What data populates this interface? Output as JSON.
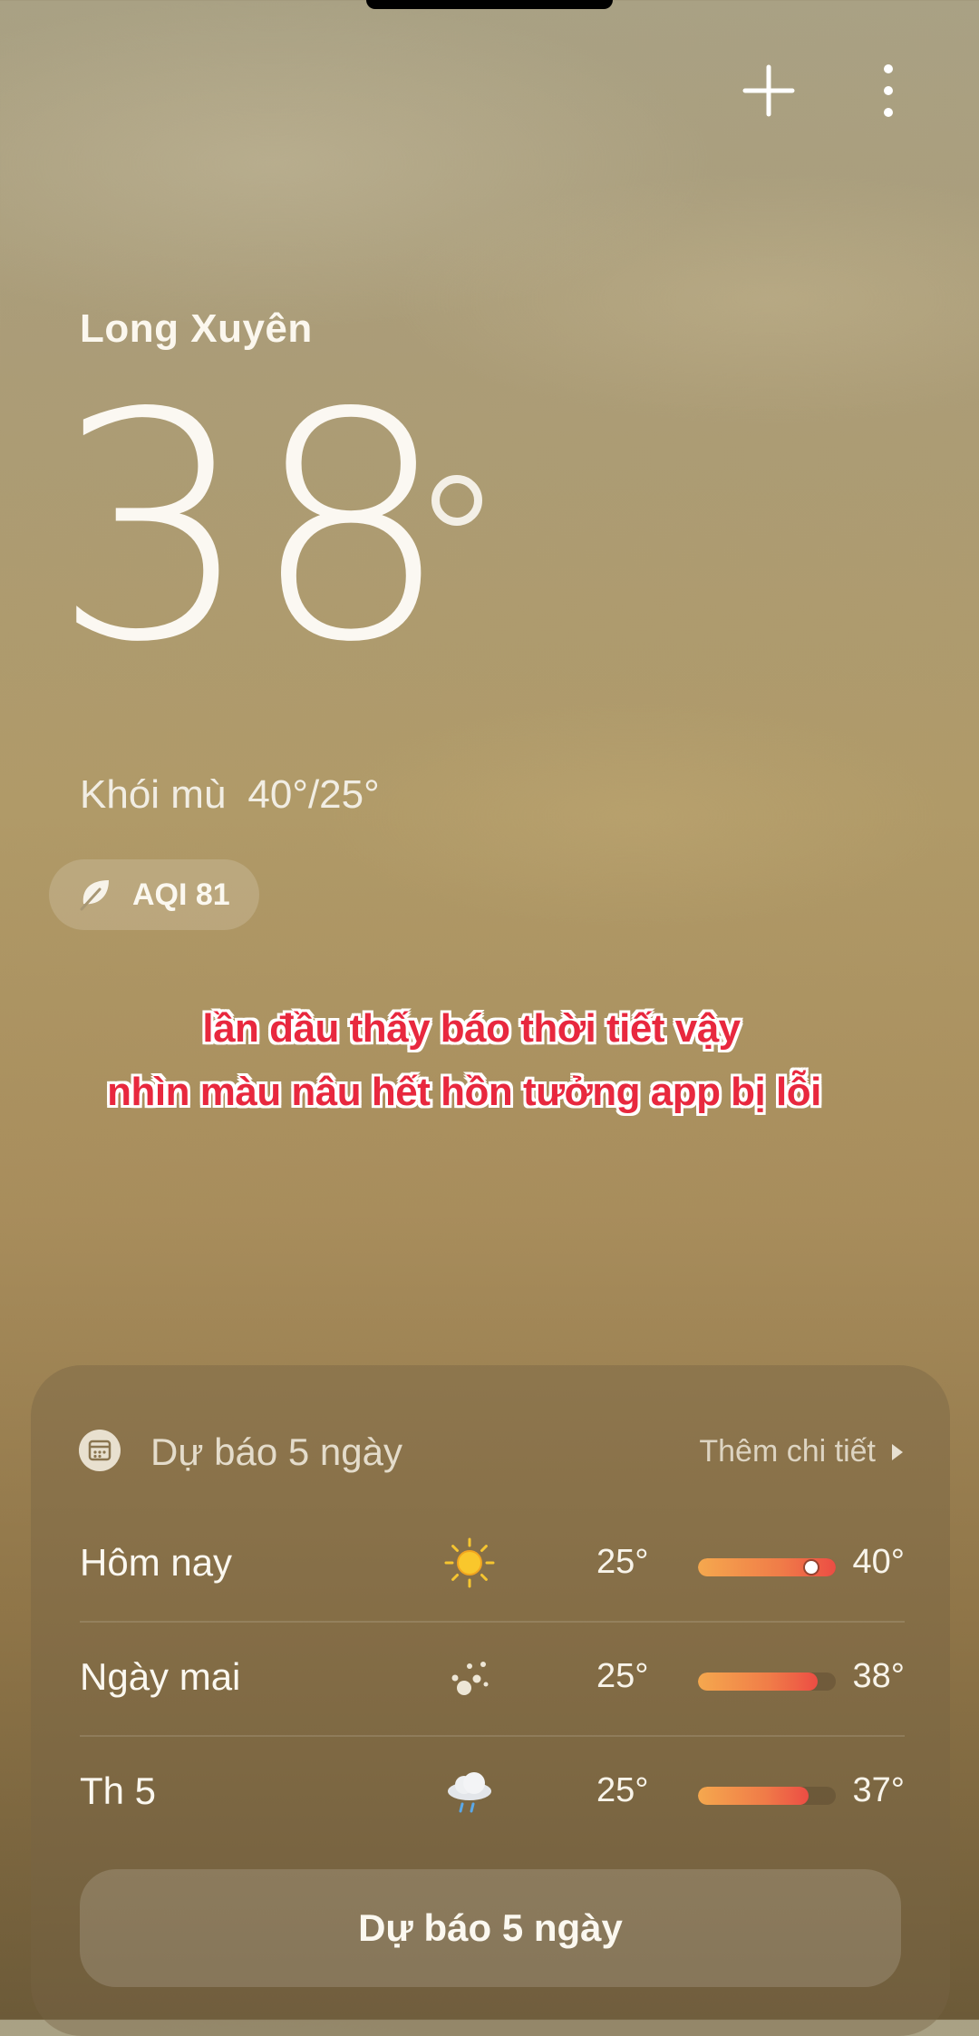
{
  "header": {
    "add_icon": "plus-icon",
    "menu_icon": "more-vertical-icon"
  },
  "current": {
    "city": "Long Xuyên",
    "temperature": "38",
    "condition": "Khói mù",
    "high_low": "40°/25°",
    "aqi": "AQI 81"
  },
  "caption": {
    "line1": "lần đầu thấy báo thời tiết vậy",
    "line2": "nhìn màu nâu hết hồn tưởng app bị lỗi",
    "color": "#e8283e"
  },
  "forecast": {
    "title": "Dự báo 5 ngày",
    "more_label": "Thêm chi tiết",
    "button_label": "Dự báo 5 ngày",
    "days": [
      {
        "day": "Hôm nay",
        "icon": "sunny-icon",
        "low": "25°",
        "high": "40°",
        "bar_fill": 1.0,
        "current_marker": 0.82
      },
      {
        "day": "Ngày mai",
        "icon": "haze-icon",
        "low": "25°",
        "high": "38°",
        "bar_fill": 0.87
      },
      {
        "day": "Th 5",
        "icon": "rain-cloud-icon",
        "low": "25°",
        "high": "37°",
        "bar_fill": 0.8
      }
    ]
  }
}
